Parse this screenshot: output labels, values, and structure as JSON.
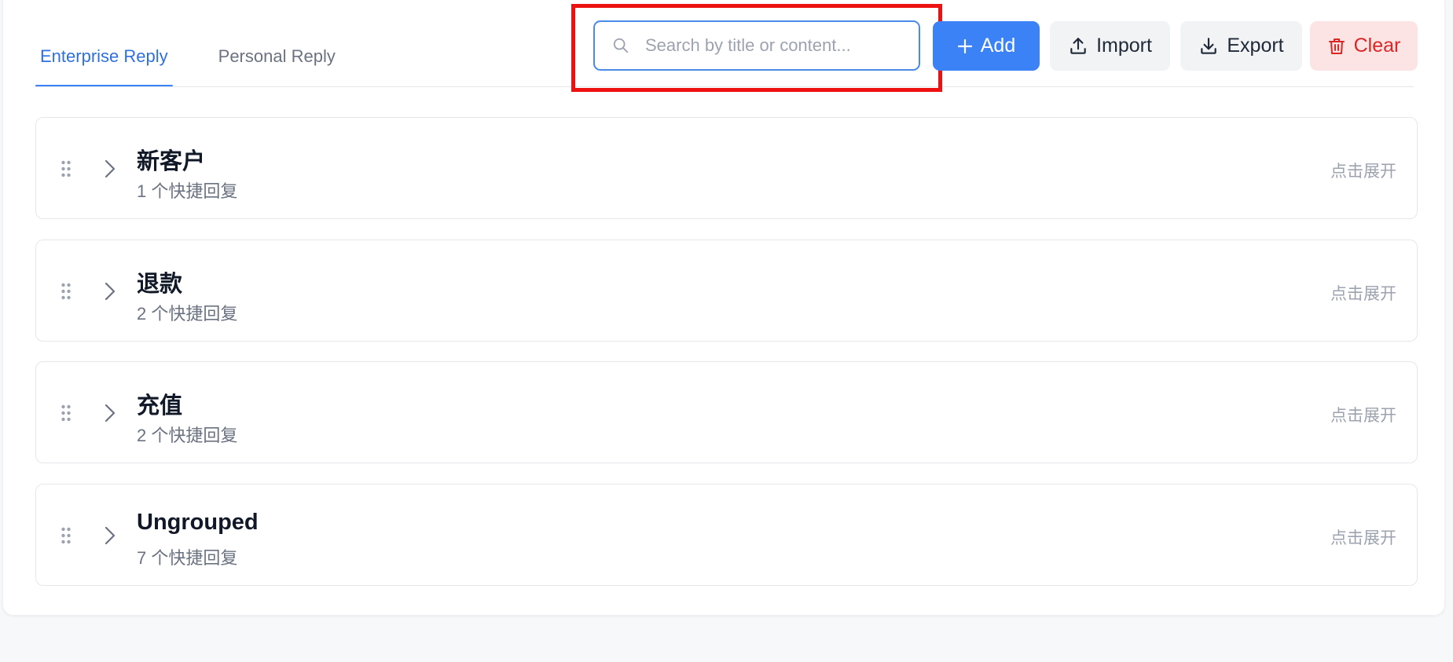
{
  "tabs": [
    {
      "label": "Enterprise Reply",
      "active": true
    },
    {
      "label": "Personal Reply",
      "active": false
    }
  ],
  "search": {
    "placeholder": "Search by title or content...",
    "value": ""
  },
  "toolbar": {
    "add_label": "Add",
    "import_label": "Import",
    "export_label": "Export",
    "clear_label": "Clear"
  },
  "groups": [
    {
      "title": "新客户",
      "count_text": "1 个快捷回复",
      "expand_text": "点击展开"
    },
    {
      "title": "退款",
      "count_text": "2 个快捷回复",
      "expand_text": "点击展开"
    },
    {
      "title": "充值",
      "count_text": "2 个快捷回复",
      "expand_text": "点击展开"
    },
    {
      "title": "Ungrouped",
      "count_text": "7 个快捷回复",
      "expand_text": "点击展开"
    }
  ],
  "colors": {
    "accent": "#3b82f6",
    "danger": "#dc2626",
    "danger_bg": "#fde4e4",
    "highlight": "#ee1111"
  },
  "icons": {
    "search": "search-icon",
    "add": "plus-icon",
    "import": "upload-icon",
    "export": "download-icon",
    "clear": "trash-icon",
    "drag": "drag-handle-icon",
    "expand": "chevron-right-icon"
  }
}
